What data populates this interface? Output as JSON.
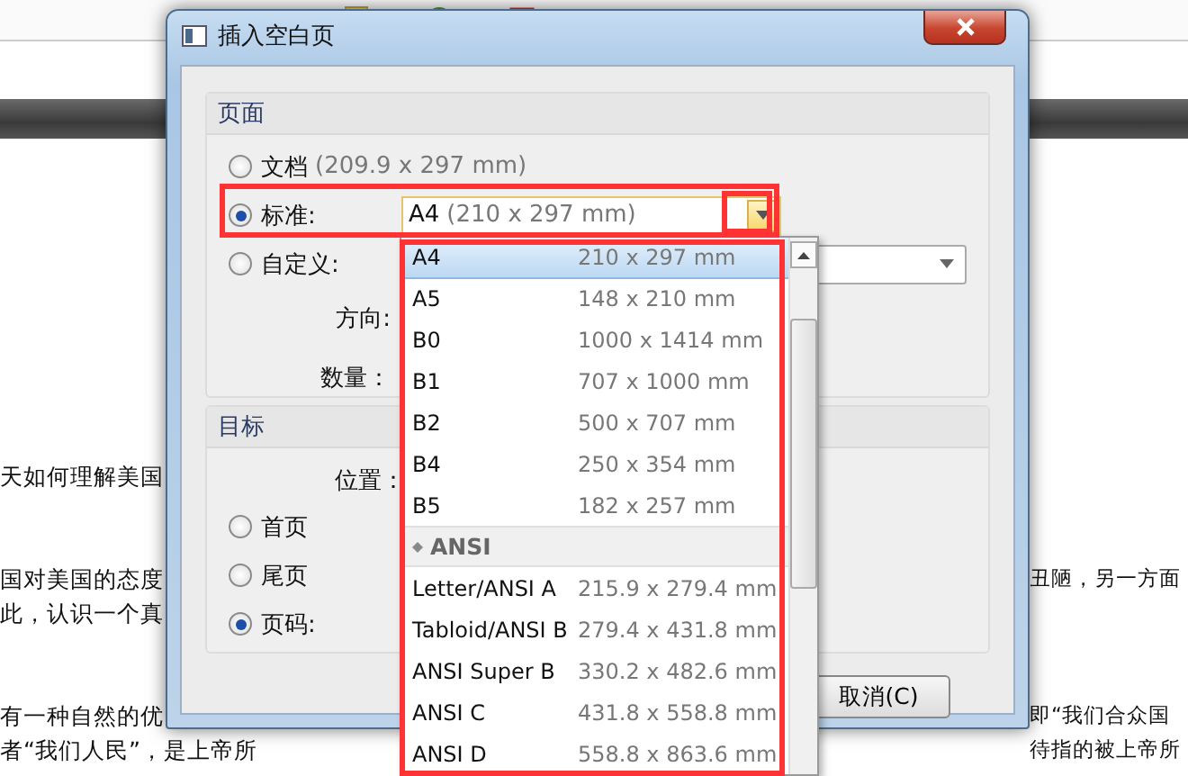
{
  "document": {
    "paragraphs": [
      {
        "lines": [
          {
            "left": "天如何理解美国"
          }
        ]
      },
      {
        "lines": [
          {
            "left": "国对美国的态度",
            "right": "丑陋，另一方面"
          },
          {
            "left": "此，认识一个真"
          }
        ]
      },
      {
        "lines": [
          {
            "left": "有一种自然的优",
            "right": "即“我们合众国"
          },
          {
            "left": "者“我们人民”，是上帝所",
            "right": "待指的被上帝所"
          }
        ]
      }
    ]
  },
  "dialog": {
    "title": "插入空白页",
    "page_group": {
      "title": "页面",
      "options": [
        {
          "label": "文档",
          "hint": "(209.9 x 297 mm)",
          "selected": false
        },
        {
          "label": "标准:",
          "selected": true
        },
        {
          "label": "自定义:",
          "selected": false
        }
      ],
      "size_combo": {
        "value": "A4",
        "hint": "(210 x 297 mm)"
      },
      "orientation_label": "方向:",
      "count_label": "数量："
    },
    "target_group": {
      "title": "目标",
      "position_label": "位置：",
      "options": [
        {
          "label": "首页",
          "selected": false
        },
        {
          "label": "尾页",
          "selected": false
        },
        {
          "label": "页码:",
          "selected": true
        }
      ]
    },
    "buttons": [
      "取消(C)"
    ]
  },
  "dropdown": {
    "items": [
      {
        "kind": "item",
        "name": "A4",
        "size": "210 x 297 mm",
        "selected": true
      },
      {
        "kind": "item",
        "name": "A5",
        "size": "148 x 210 mm",
        "selected": false
      },
      {
        "kind": "item",
        "name": "B0",
        "size": "1000 x 1414 mm",
        "selected": false
      },
      {
        "kind": "item",
        "name": "B1",
        "size": "707 x 1000 mm",
        "selected": false
      },
      {
        "kind": "item",
        "name": "B2",
        "size": "500 x 707 mm",
        "selected": false
      },
      {
        "kind": "item",
        "name": "B4",
        "size": "250 x 354 mm",
        "selected": false
      },
      {
        "kind": "item",
        "name": "B5",
        "size": "182 x 257 mm",
        "selected": false
      },
      {
        "kind": "header",
        "name": "ANSI"
      },
      {
        "kind": "item",
        "name": "Letter/ANSI A",
        "size": "215.9 x 279.4 mm",
        "selected": false
      },
      {
        "kind": "item",
        "name": "Tabloid/ANSI B",
        "size": "279.4 x 431.8 mm",
        "selected": false
      },
      {
        "kind": "item",
        "name": "ANSI Super B",
        "size": "330.2 x 482.6 mm",
        "selected": false
      },
      {
        "kind": "item",
        "name": "ANSI C",
        "size": "431.8 x 558.8 mm",
        "selected": false
      },
      {
        "kind": "item",
        "name": "ANSI D",
        "size": "558.8 x 863.6 mm",
        "selected": false
      }
    ]
  }
}
